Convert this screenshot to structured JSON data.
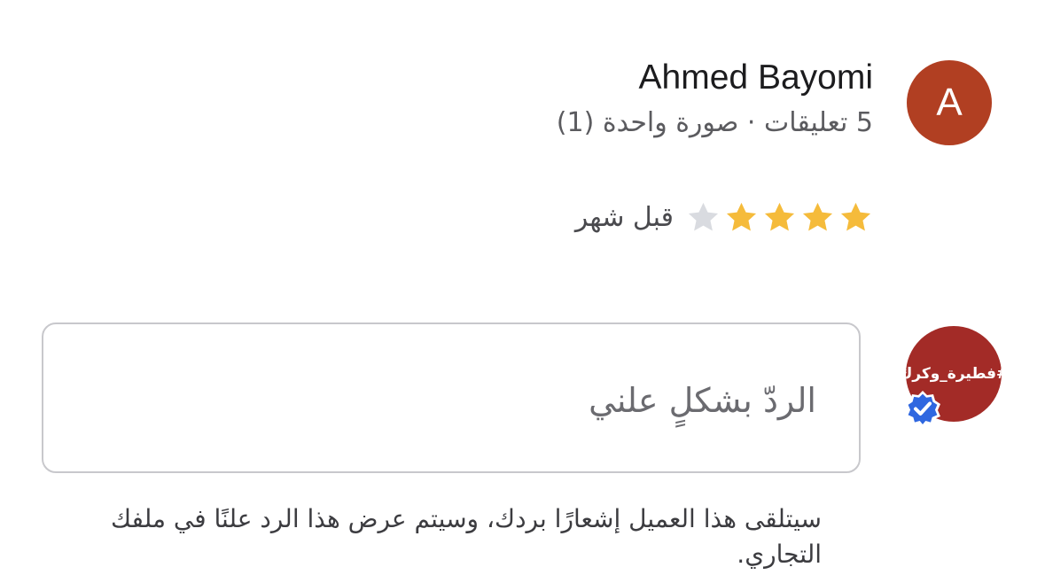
{
  "reviewer": {
    "initial": "A",
    "name": "Ahmed Bayomi",
    "meta": "5 تعليقات · صورة واحدة (1)",
    "avatar_color": "#b13f22"
  },
  "review": {
    "rating": 4,
    "max_rating": 5,
    "time": "قبل شهر",
    "star_filled_color": "#f5bb3b",
    "star_empty_color": "#d9dbe0"
  },
  "business": {
    "avatar_text": "#فطيرة_وكرك",
    "avatar_color": "#a32b27",
    "verified_color": "#2f67e0"
  },
  "reply": {
    "placeholder": "الردّ بشكلٍ علني",
    "notice": "سيتلقى هذا العميل إشعارًا بردك، وسيتم عرض هذا الرد علنًا في ملفك التجاري."
  }
}
